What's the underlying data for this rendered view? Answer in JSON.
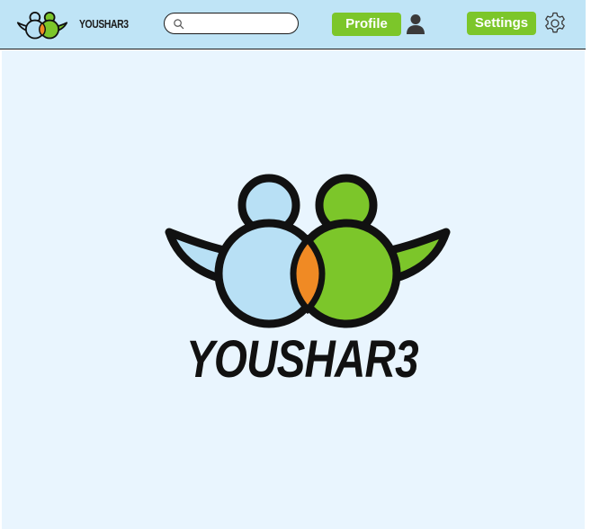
{
  "header": {
    "brand_name": "YOUSHAR3",
    "search": {
      "value": "",
      "placeholder": ""
    },
    "profile_label": "Profile",
    "settings_label": "Settings"
  },
  "main": {
    "brand_name": "YOUSHAR3"
  },
  "colors": {
    "header_bg": "#bfe4f6",
    "main_bg": "#e9f5fe",
    "button_green": "#7cc62a",
    "logo_blue": "#b8e0f5",
    "logo_green": "#7cc62a",
    "logo_overlap": "#f08a24"
  },
  "icons": {
    "brand": "youshar3-logo-icon",
    "search": "search-icon",
    "user": "user-icon",
    "settings": "gear-icon"
  }
}
